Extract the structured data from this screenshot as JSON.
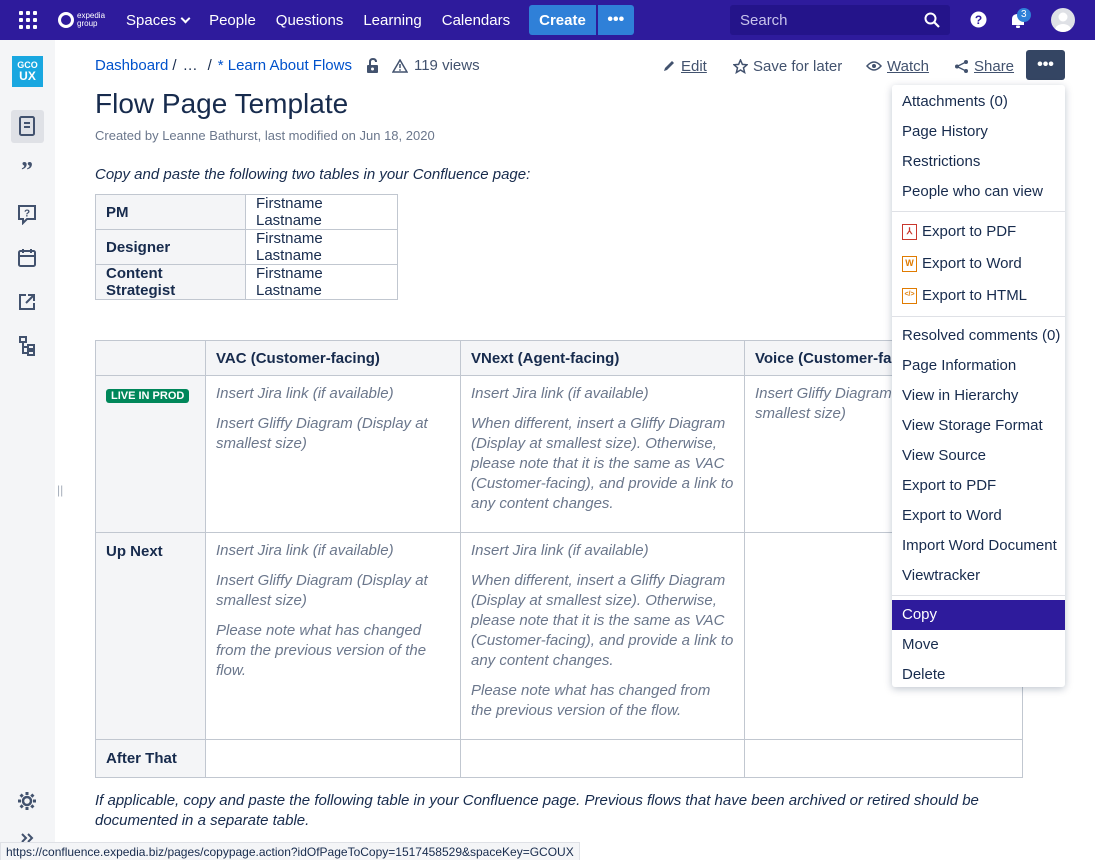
{
  "topnav": {
    "logo_text_1": "expedia",
    "logo_text_2": "group",
    "items": [
      "Spaces",
      "People",
      "Questions",
      "Learning",
      "Calendars"
    ],
    "create_label": "Create",
    "create_more": "•••",
    "search_placeholder": "Search",
    "notification_count": "3"
  },
  "sidebar": {
    "space_logo_line1": "GCO",
    "space_logo_line2": "UX",
    "resize_handle": "||"
  },
  "breadcrumb": {
    "items": [
      "Dashboard",
      "…",
      "* Learn About Flows"
    ],
    "separator": "/",
    "views": "119 views"
  },
  "actions": {
    "edit": "Edit",
    "save_for_later": "Save for later",
    "watch": "Watch",
    "share": "Share",
    "more": "•••"
  },
  "page": {
    "title": "Flow Page Template",
    "byline": "Created by Leanne Bathurst, last modified on Jun 18, 2020",
    "intro": "Copy and paste the following two tables in your Confluence page:",
    "footer": "If applicable, copy and paste the following table in your Confluence page. Previous flows that have been archived or retired should be documented in a separate table."
  },
  "roles_table": [
    {
      "role": "PM",
      "name": "Firstname Lastname"
    },
    {
      "role": "Designer",
      "name": "Firstname Lastname"
    },
    {
      "role": "Content Strategist",
      "name": "Firstname Lastname"
    }
  ],
  "flow_table": {
    "headers": [
      "",
      "VAC (Customer-facing)",
      "VNext (Agent-facing)",
      "Voice (Customer-facing)"
    ],
    "live_lozenge": "LIVE IN PROD",
    "row2_label": "Up Next",
    "row3_label": "After That",
    "jira": "Insert Jira link (if available)",
    "gliffy": "Insert Gliffy Diagram (Display at smallest size)",
    "gliffy_when_different": "When different, insert a Gliffy Diagram (Display at smallest size). Otherwise, please note that it is the same as VAC (Customer-facing), and provide a link to any content changes.",
    "note_changes": "Please note what has changed from the previous version of the flow."
  },
  "menu": {
    "items": [
      "Attachments (0)",
      "Page History",
      "Restrictions",
      "People who can view",
      "Export to PDF",
      "Export to Word",
      "Export to HTML",
      "Resolved comments (0)",
      "Page Information",
      "View in Hierarchy",
      "View Storage Format",
      "View Source",
      "Export to PDF",
      "Export to Word",
      "Import Word Document",
      "Viewtracker",
      "Copy",
      "Move",
      "Delete"
    ],
    "selected": "Copy"
  },
  "status_url": "https://confluence.expedia.biz/pages/copypage.action?idOfPageToCopy=1517458529&spaceKey=GCOUX",
  "colors": {
    "nav_bg": "#2e1b9c",
    "create_btn": "#2f80d8",
    "lozenge_green": "#00875a",
    "link_blue": "#0052cc"
  }
}
